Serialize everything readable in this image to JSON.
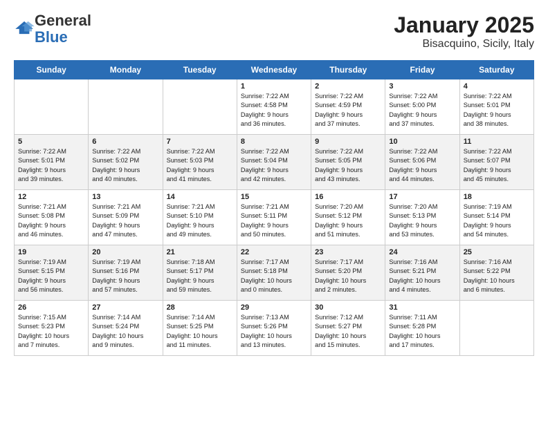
{
  "header": {
    "logo": {
      "general": "General",
      "blue": "Blue"
    },
    "title": "January 2025",
    "location": "Bisacquino, Sicily, Italy"
  },
  "days_of_week": [
    "Sunday",
    "Monday",
    "Tuesday",
    "Wednesday",
    "Thursday",
    "Friday",
    "Saturday"
  ],
  "weeks": [
    [
      {
        "day": "",
        "info": ""
      },
      {
        "day": "",
        "info": ""
      },
      {
        "day": "",
        "info": ""
      },
      {
        "day": "1",
        "info": "Sunrise: 7:22 AM\nSunset: 4:58 PM\nDaylight: 9 hours\nand 36 minutes."
      },
      {
        "day": "2",
        "info": "Sunrise: 7:22 AM\nSunset: 4:59 PM\nDaylight: 9 hours\nand 37 minutes."
      },
      {
        "day": "3",
        "info": "Sunrise: 7:22 AM\nSunset: 5:00 PM\nDaylight: 9 hours\nand 37 minutes."
      },
      {
        "day": "4",
        "info": "Sunrise: 7:22 AM\nSunset: 5:01 PM\nDaylight: 9 hours\nand 38 minutes."
      }
    ],
    [
      {
        "day": "5",
        "info": "Sunrise: 7:22 AM\nSunset: 5:01 PM\nDaylight: 9 hours\nand 39 minutes."
      },
      {
        "day": "6",
        "info": "Sunrise: 7:22 AM\nSunset: 5:02 PM\nDaylight: 9 hours\nand 40 minutes."
      },
      {
        "day": "7",
        "info": "Sunrise: 7:22 AM\nSunset: 5:03 PM\nDaylight: 9 hours\nand 41 minutes."
      },
      {
        "day": "8",
        "info": "Sunrise: 7:22 AM\nSunset: 5:04 PM\nDaylight: 9 hours\nand 42 minutes."
      },
      {
        "day": "9",
        "info": "Sunrise: 7:22 AM\nSunset: 5:05 PM\nDaylight: 9 hours\nand 43 minutes."
      },
      {
        "day": "10",
        "info": "Sunrise: 7:22 AM\nSunset: 5:06 PM\nDaylight: 9 hours\nand 44 minutes."
      },
      {
        "day": "11",
        "info": "Sunrise: 7:22 AM\nSunset: 5:07 PM\nDaylight: 9 hours\nand 45 minutes."
      }
    ],
    [
      {
        "day": "12",
        "info": "Sunrise: 7:21 AM\nSunset: 5:08 PM\nDaylight: 9 hours\nand 46 minutes."
      },
      {
        "day": "13",
        "info": "Sunrise: 7:21 AM\nSunset: 5:09 PM\nDaylight: 9 hours\nand 47 minutes."
      },
      {
        "day": "14",
        "info": "Sunrise: 7:21 AM\nSunset: 5:10 PM\nDaylight: 9 hours\nand 49 minutes."
      },
      {
        "day": "15",
        "info": "Sunrise: 7:21 AM\nSunset: 5:11 PM\nDaylight: 9 hours\nand 50 minutes."
      },
      {
        "day": "16",
        "info": "Sunrise: 7:20 AM\nSunset: 5:12 PM\nDaylight: 9 hours\nand 51 minutes."
      },
      {
        "day": "17",
        "info": "Sunrise: 7:20 AM\nSunset: 5:13 PM\nDaylight: 9 hours\nand 53 minutes."
      },
      {
        "day": "18",
        "info": "Sunrise: 7:19 AM\nSunset: 5:14 PM\nDaylight: 9 hours\nand 54 minutes."
      }
    ],
    [
      {
        "day": "19",
        "info": "Sunrise: 7:19 AM\nSunset: 5:15 PM\nDaylight: 9 hours\nand 56 minutes."
      },
      {
        "day": "20",
        "info": "Sunrise: 7:19 AM\nSunset: 5:16 PM\nDaylight: 9 hours\nand 57 minutes."
      },
      {
        "day": "21",
        "info": "Sunrise: 7:18 AM\nSunset: 5:17 PM\nDaylight: 9 hours\nand 59 minutes."
      },
      {
        "day": "22",
        "info": "Sunrise: 7:17 AM\nSunset: 5:18 PM\nDaylight: 10 hours\nand 0 minutes."
      },
      {
        "day": "23",
        "info": "Sunrise: 7:17 AM\nSunset: 5:20 PM\nDaylight: 10 hours\nand 2 minutes."
      },
      {
        "day": "24",
        "info": "Sunrise: 7:16 AM\nSunset: 5:21 PM\nDaylight: 10 hours\nand 4 minutes."
      },
      {
        "day": "25",
        "info": "Sunrise: 7:16 AM\nSunset: 5:22 PM\nDaylight: 10 hours\nand 6 minutes."
      }
    ],
    [
      {
        "day": "26",
        "info": "Sunrise: 7:15 AM\nSunset: 5:23 PM\nDaylight: 10 hours\nand 7 minutes."
      },
      {
        "day": "27",
        "info": "Sunrise: 7:14 AM\nSunset: 5:24 PM\nDaylight: 10 hours\nand 9 minutes."
      },
      {
        "day": "28",
        "info": "Sunrise: 7:14 AM\nSunset: 5:25 PM\nDaylight: 10 hours\nand 11 minutes."
      },
      {
        "day": "29",
        "info": "Sunrise: 7:13 AM\nSunset: 5:26 PM\nDaylight: 10 hours\nand 13 minutes."
      },
      {
        "day": "30",
        "info": "Sunrise: 7:12 AM\nSunset: 5:27 PM\nDaylight: 10 hours\nand 15 minutes."
      },
      {
        "day": "31",
        "info": "Sunrise: 7:11 AM\nSunset: 5:28 PM\nDaylight: 10 hours\nand 17 minutes."
      },
      {
        "day": "",
        "info": ""
      }
    ]
  ]
}
